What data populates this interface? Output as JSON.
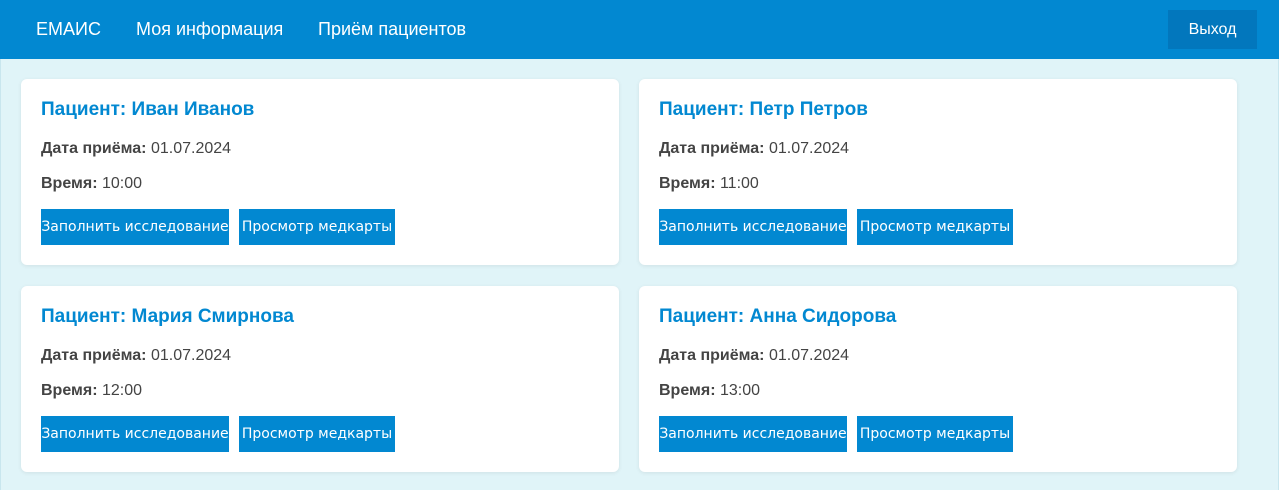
{
  "navbar": {
    "brand": "ЕМАИС",
    "links": [
      "Моя информация",
      "Приём пациентов"
    ],
    "logout_label": "Выход"
  },
  "labels": {
    "date": "Дата приёма:",
    "time": "Время:"
  },
  "cards": [
    {
      "title": "Пациент: Иван Иванов",
      "date": "01.07.2024",
      "time": "10:00",
      "fill_button": "Заполнить исследование",
      "view_button": "Просмотр медкарты"
    },
    {
      "title": "Пациент: Петр Петров",
      "date": "01.07.2024",
      "time": "11:00",
      "fill_button": "Заполнить исследование",
      "view_button": "Просмотр медкарты"
    },
    {
      "title": "Пациент: Мария Смирнова",
      "date": "01.07.2024",
      "time": "12:00",
      "fill_button": "Заполнить исследование",
      "view_button": "Просмотр медкарты"
    },
    {
      "title": "Пациент: Анна Сидорова",
      "date": "01.07.2024",
      "time": "13:00",
      "fill_button": "Заполнить исследование",
      "view_button": "Просмотр медкарты"
    }
  ],
  "colors": {
    "primary": "#0288d1",
    "primary_dark": "#0277bd",
    "background": "#e0f4f8",
    "card": "#ffffff",
    "text": "#444444"
  }
}
